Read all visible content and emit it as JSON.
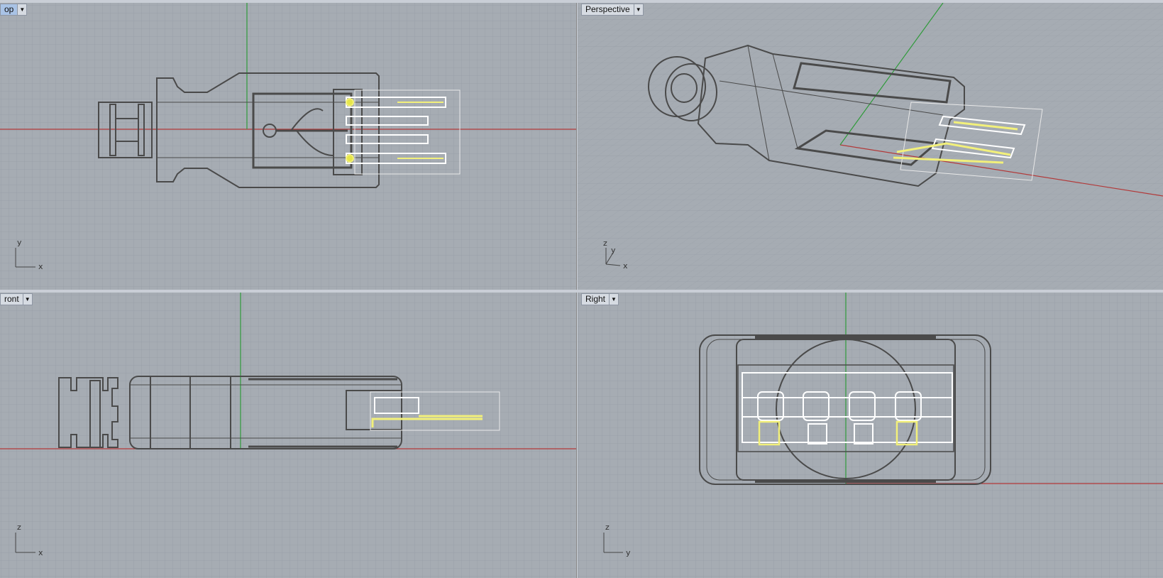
{
  "viewports": {
    "top": {
      "label": "op",
      "axes": {
        "v": "y",
        "h": "x"
      }
    },
    "perspective": {
      "label": "Perspective",
      "axes": {
        "v": "z",
        "v2": "y",
        "h": "x"
      }
    },
    "front": {
      "label": "ront",
      "axes": {
        "v": "z",
        "h": "x"
      }
    },
    "right": {
      "label": "Right",
      "axes": {
        "v": "z",
        "h": "y"
      }
    }
  },
  "icons": {
    "viewport_menu": "chevron-down-icon"
  },
  "colors": {
    "background": "#a6acb3",
    "grid_minor": "#9aa0a8",
    "grid_major": "#8a9098",
    "x_axis": "#b23a3a",
    "y_axis": "#2f9a3a",
    "wire": "#4a4a4a",
    "selected": "#ffffff",
    "highlight": "#f2f07a"
  }
}
